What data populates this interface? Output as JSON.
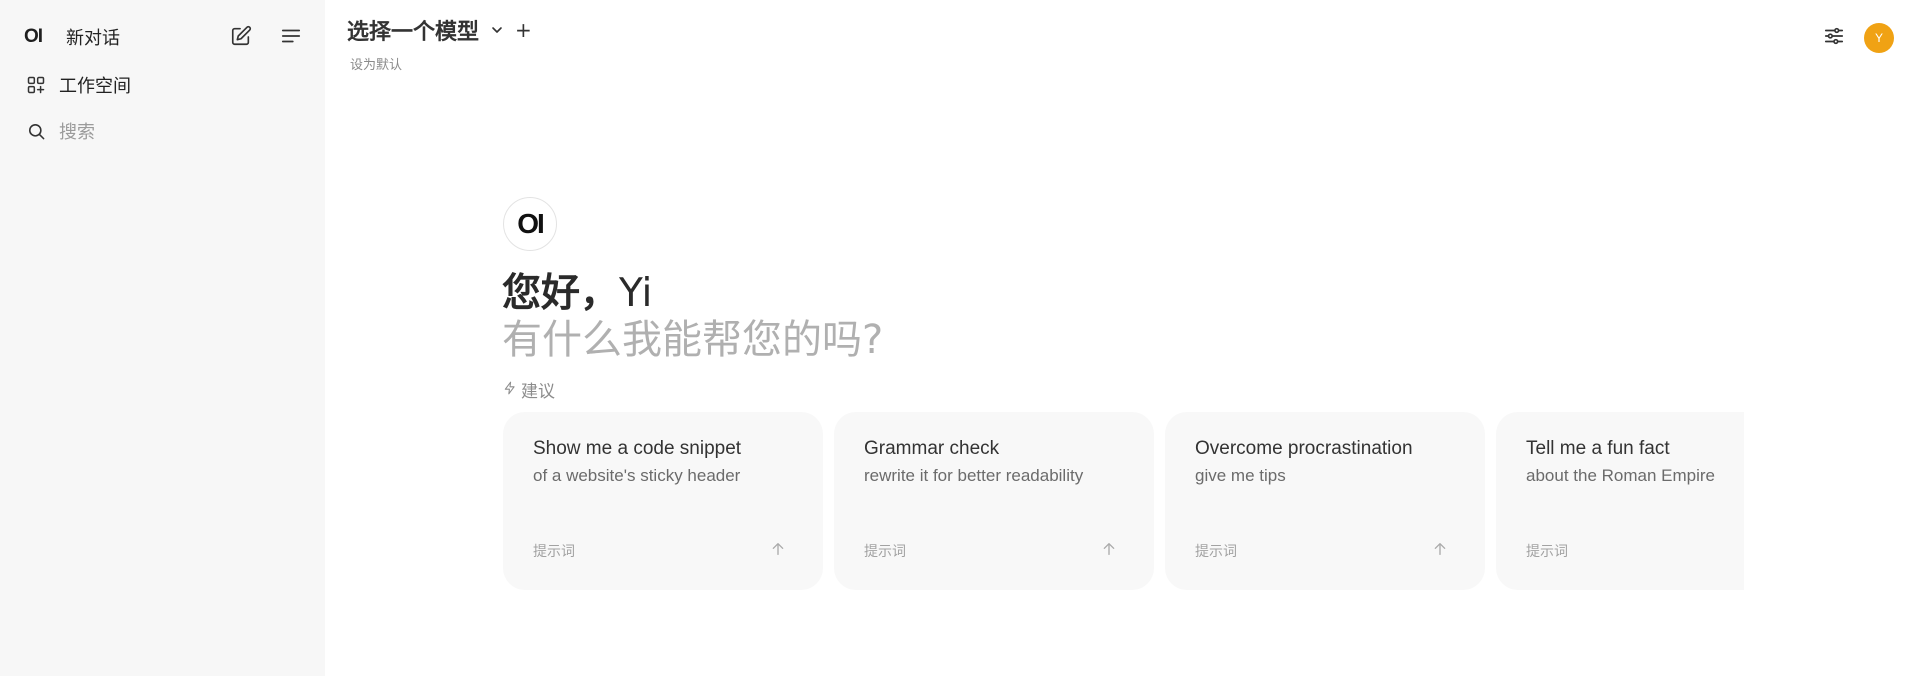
{
  "sidebar": {
    "logo_text": "OI",
    "new_chat_label": "新对话",
    "workspace_label": "工作空间",
    "search_placeholder": "搜索"
  },
  "header": {
    "model_selector_label": "选择一个模型",
    "add_model_symbol": "+",
    "set_default_label": "设为默认",
    "avatar_initial": "Y",
    "avatar_color": "#f0a214"
  },
  "hero": {
    "logo_text": "OI",
    "greeting_prefix": "您好，",
    "user_name": "Yi",
    "subtitle": "有什么我能帮您的吗?"
  },
  "suggestions": {
    "label": "建议",
    "items": [
      {
        "title": "Show me a code snippet",
        "subtitle": "of a website's sticky header",
        "tag": "提示词"
      },
      {
        "title": "Grammar check",
        "subtitle": "rewrite it for better readability",
        "tag": "提示词"
      },
      {
        "title": "Overcome procrastination",
        "subtitle": "give me tips",
        "tag": "提示词"
      },
      {
        "title": "Tell me a fun fact",
        "subtitle": "about the Roman Empire",
        "tag": "提示词"
      }
    ]
  }
}
